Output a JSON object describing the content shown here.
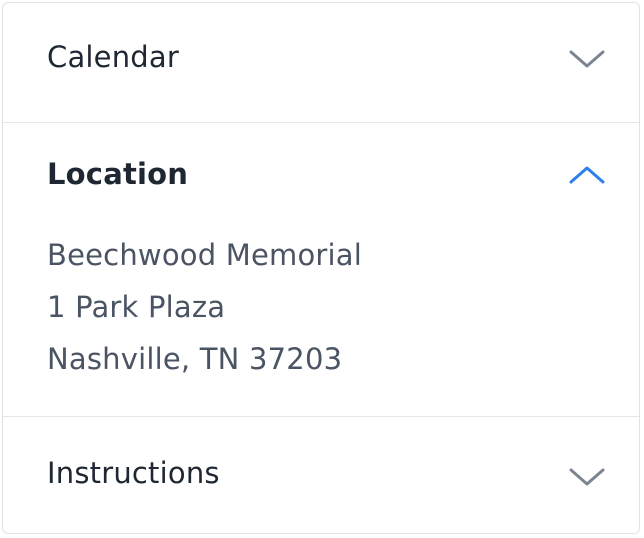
{
  "accordion": {
    "sections": [
      {
        "title": "Calendar",
        "expanded": false,
        "chevron_icon": "chevron-down-icon"
      },
      {
        "title": "Location",
        "expanded": true,
        "chevron_icon": "chevron-up-icon",
        "lines": [
          "Beechwood Memorial",
          "1 Park Plaza",
          "Nashville, TN 37203"
        ]
      },
      {
        "title": "Instructions",
        "expanded": false,
        "chevron_icon": "chevron-down-icon"
      }
    ]
  },
  "colors": {
    "chevron_collapsed": "#7a8591",
    "chevron_expanded": "#2f80ed",
    "title_text": "#1f2733",
    "body_text": "#4a5463",
    "divider": "#e3e6ea"
  }
}
